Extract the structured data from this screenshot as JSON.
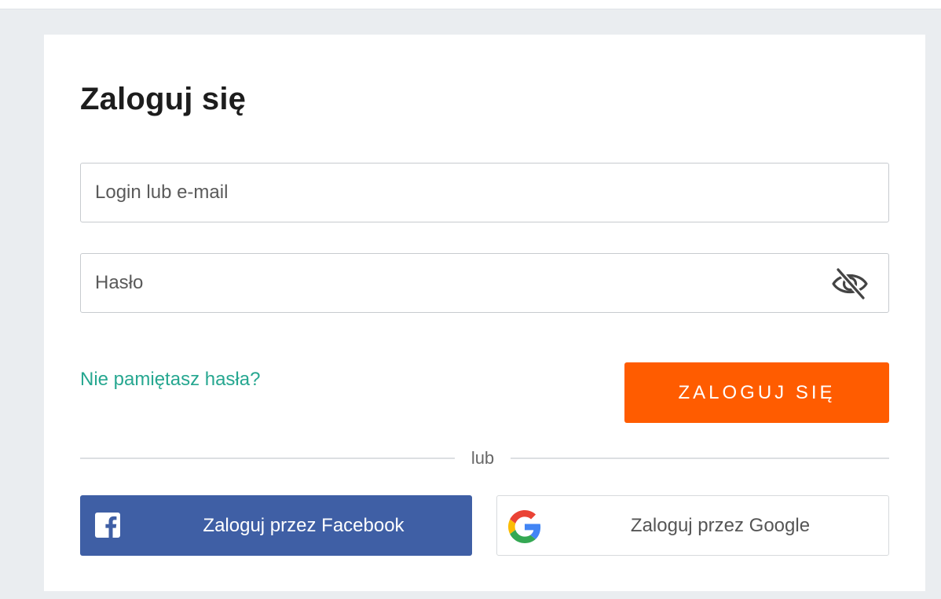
{
  "login_form": {
    "title": "Zaloguj się",
    "login_field": {
      "placeholder": "Login lub e-mail",
      "value": ""
    },
    "password_field": {
      "placeholder": "Hasło",
      "value": "",
      "visibility_icon": "eye-slash-icon"
    },
    "forgot_password_link": "Nie pamiętasz hasła?",
    "submit_label": "ZALOGUJ SIĘ",
    "divider_text": "lub",
    "social": {
      "facebook_label": "Zaloguj przez Facebook",
      "google_label": "Zaloguj przez Google"
    }
  },
  "colors": {
    "page_background": "#eaedf0",
    "primary_button": "#ff5c00",
    "link": "#26a790",
    "facebook": "#3f5fa5"
  }
}
